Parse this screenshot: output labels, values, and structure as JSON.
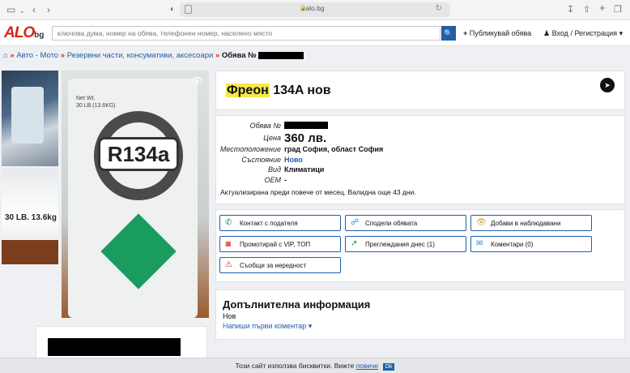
{
  "browser": {
    "url": "alo.bg"
  },
  "header": {
    "logo_main": "ALO",
    "logo_suffix": "bg",
    "search_placeholder": "ключова дума, номер на обява, телефонен номер, населено място",
    "publish_label": "Публикувай обява",
    "login_label": "Вход / Регистрация"
  },
  "breadcrumb": {
    "items": [
      "Авто - Мото",
      "Резервни части, консумативи, аксесоари"
    ],
    "current_prefix": "Обява №"
  },
  "listing": {
    "title_highlight": "Фреон",
    "title_rest": " 134A нов",
    "photo": {
      "net_wt_line1": "Net Wt.",
      "net_wt_line2": "30 LB.(13.6KG)",
      "product_code": "R134a",
      "thumb_label": "30 LB. 13.6kg"
    },
    "details": {
      "id_label": "Обява №",
      "price_label": "Цена",
      "price": "360 лв.",
      "location_label": "Местоположение",
      "location": "град София, област София",
      "condition_label": "Състояние",
      "condition": "Ново",
      "type_label": "Вид",
      "type": "Климатици",
      "oem_label": "OEM",
      "oem": "-",
      "updated": "Актуализирана преди повече от месец. Валидна още 43 дни."
    },
    "actions": {
      "contact": "Контакт с подателя",
      "share": "Сподели обявата",
      "watch": "Добави в наблюдавани",
      "promote": "Промотирай с VIP, ТОП",
      "views": "Преглеждания днес (1)",
      "comments": "Коментари (0)",
      "report": "Съобщи за нередност"
    },
    "info": {
      "heading": "Допълнителна информация",
      "value": "Нов",
      "first_comment": "Напиши първи коментар"
    }
  },
  "cookie": {
    "text": "Този сайт използва бисквитки. Вижте",
    "link": "повече",
    "ok": "Ok"
  }
}
